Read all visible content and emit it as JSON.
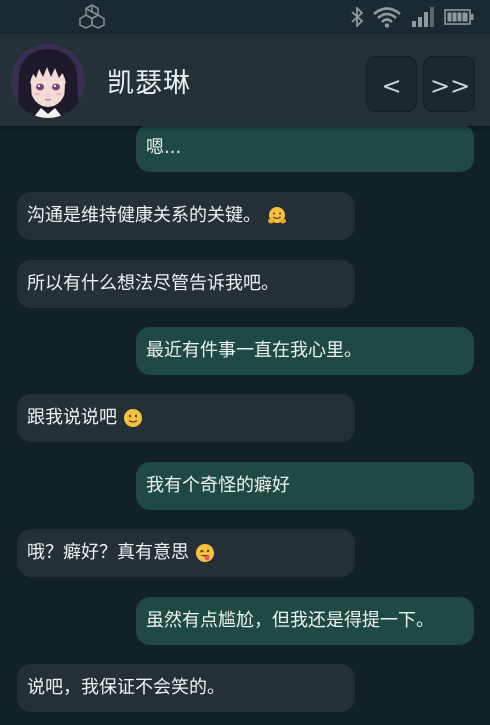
{
  "status_bar": {
    "left_icon": "app-cube-icon",
    "icons": [
      "bluetooth-icon",
      "wifi-icon",
      "signal-icon",
      "battery-icon"
    ]
  },
  "header": {
    "contact_name": "凯瑟琳",
    "avatar": "anime-girl-avatar",
    "prev_label": "<",
    "next_label": ">>"
  },
  "messages": [
    {
      "side": "outgoing",
      "text": "嗯..."
    },
    {
      "side": "incoming",
      "text": "沟通是维持健康关系的关键。",
      "emoji": "hugging-face-emoji"
    },
    {
      "side": "incoming",
      "text": "所以有什么想法尽管告诉我吧。"
    },
    {
      "side": "outgoing",
      "text": "最近有件事一直在我心里。"
    },
    {
      "side": "incoming",
      "text": "跟我说说吧",
      "emoji": "slight-smile-emoji"
    },
    {
      "side": "outgoing",
      "text": "我有个奇怪的癖好"
    },
    {
      "side": "incoming",
      "text": "哦？癖好？真有意思",
      "emoji": "winking-tongue-emoji"
    },
    {
      "side": "outgoing",
      "text": "虽然有点尴尬，但我还是得提一下。"
    },
    {
      "side": "incoming",
      "text": "说吧，我保证不会笑的。"
    }
  ],
  "colors": {
    "background": "#112126",
    "header": "#243238",
    "incoming_bubble": "#252f36",
    "outgoing_bubble": "#1f4a44"
  }
}
